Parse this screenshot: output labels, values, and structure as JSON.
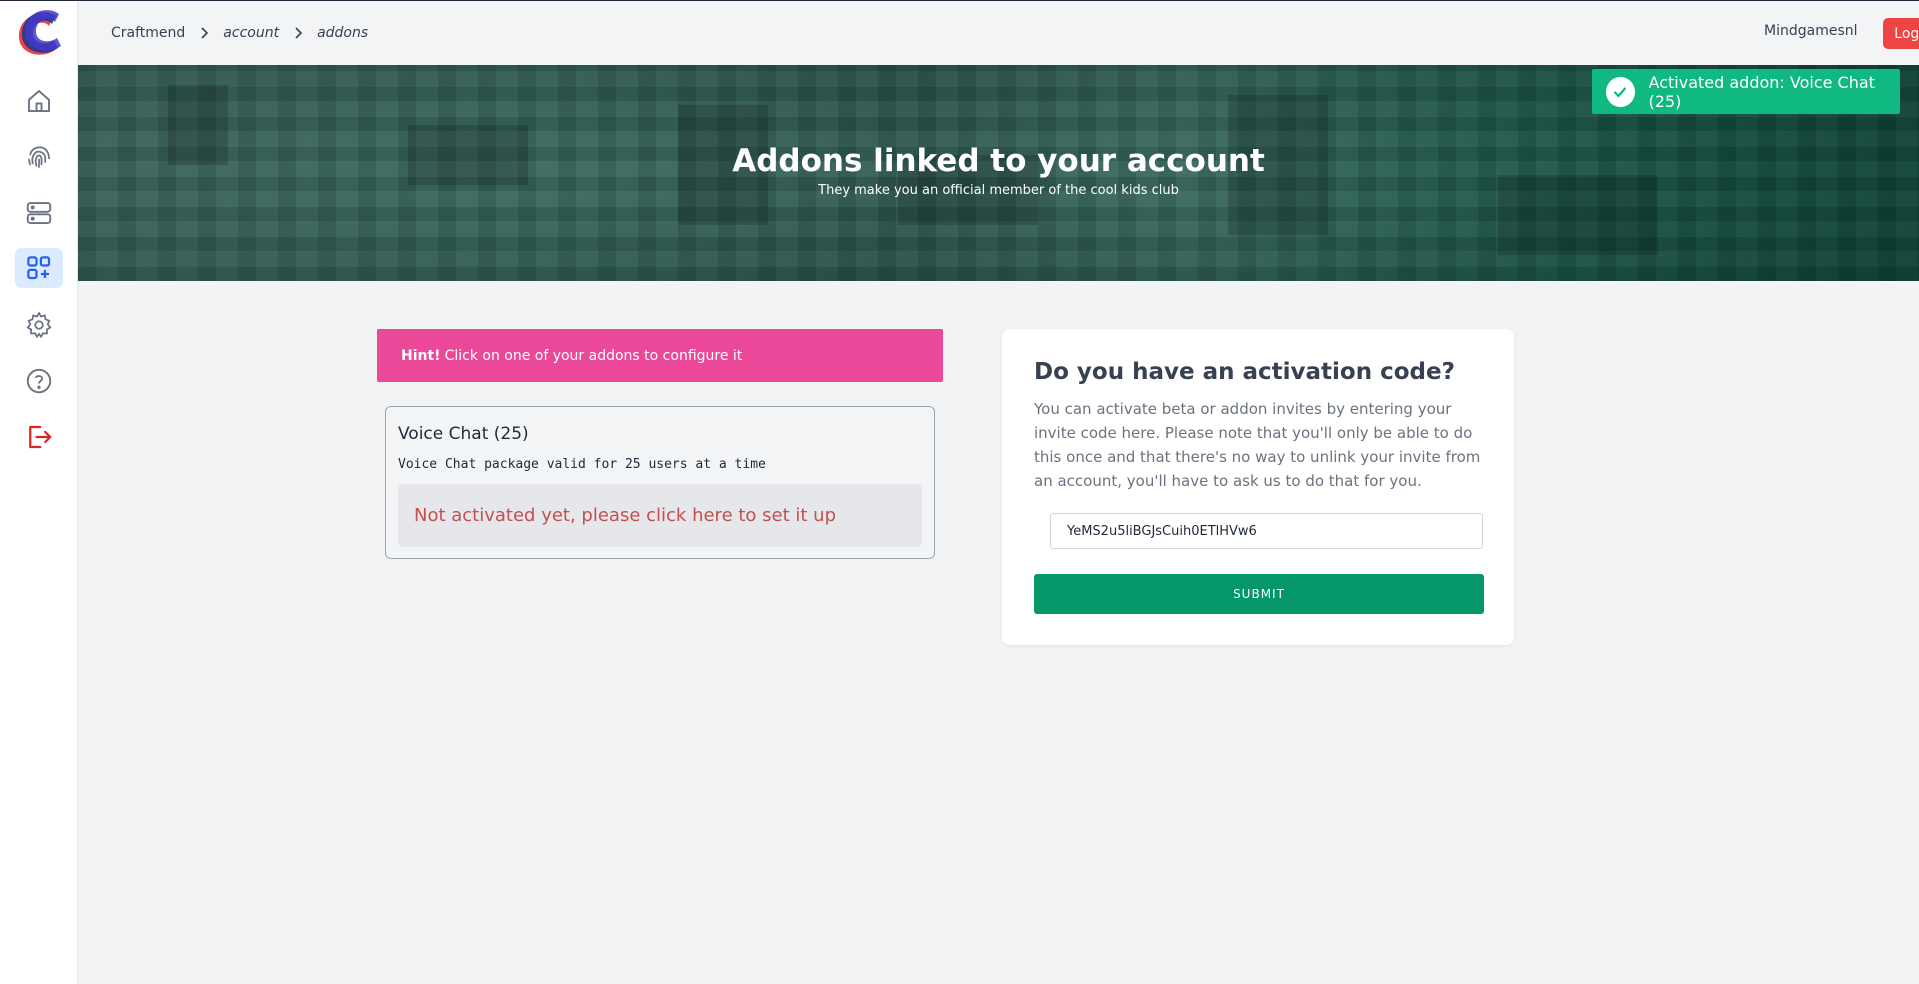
{
  "header": {
    "breadcrumb": [
      "Craftmend",
      "account",
      "addons"
    ],
    "user_name": "Mindgamesnl",
    "logout_label": "Log out"
  },
  "sidebar": {
    "items": [
      {
        "icon": "home-icon"
      },
      {
        "icon": "fingerprint-icon"
      },
      {
        "icon": "server-icon"
      },
      {
        "icon": "addons-icon",
        "active": true
      },
      {
        "icon": "gear-icon"
      },
      {
        "icon": "help-icon"
      },
      {
        "icon": "logout-icon"
      }
    ]
  },
  "banner": {
    "title": "Addons linked to your account",
    "subtitle": "They make you an official member of the cool kids club"
  },
  "toast": {
    "text": "Activated addon: Voice Chat (25)"
  },
  "hint": {
    "label": "Hint!",
    "text": "Click on one of your addons to configure it"
  },
  "addons": [
    {
      "title": "Voice Chat (25)",
      "description": "Voice Chat package valid for 25 users at a time",
      "status": "Not activated yet, please click here to set it up"
    }
  ],
  "activation": {
    "title": "Do you have an activation code?",
    "text": "You can activate beta or addon invites by entering your invite code here. Please note that you'll only be able to do this once and that there's no way to unlink your invite from an account, you'll have to ask us to do that for you.",
    "input_value": "YeMS2u5liBGJsCuih0ETlHVw6",
    "submit_label": "SUBMIT"
  },
  "colors": {
    "accent": "#2563eb",
    "danger": "#ef4444",
    "success": "#10b981",
    "hint": "#ec4899",
    "submit": "#059669"
  }
}
